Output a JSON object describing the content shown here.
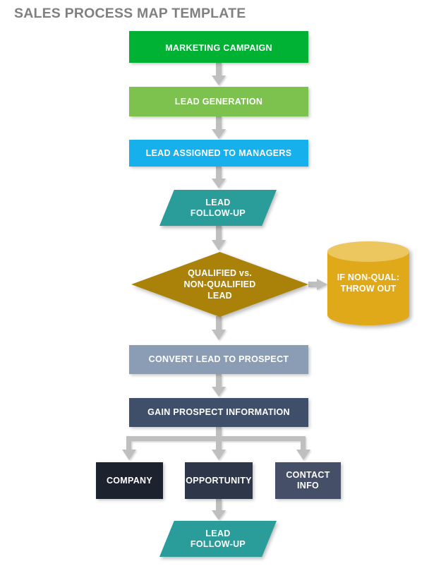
{
  "page": {
    "title": "SALES PROCESS MAP TEMPLATE",
    "background": "#ffffff",
    "title_color": "#808080",
    "connector_color": "#bfbfbf",
    "accent_bar_color": "#00b233"
  },
  "nodes": {
    "marketing_campaign": {
      "label": "MARKETING CAMPAIGN",
      "shape": "rectangle",
      "color": "#00b233"
    },
    "lead_generation": {
      "label": "LEAD GENERATION",
      "shape": "rectangle",
      "color": "#7dc24f"
    },
    "lead_assigned": {
      "label": "LEAD ASSIGNED TO MANAGERS",
      "shape": "rectangle",
      "color": "#16b0ec"
    },
    "lead_followup_top": {
      "label_line1": "LEAD",
      "label_line2": "FOLLOW-UP",
      "shape": "parallelogram",
      "color": "#2a9d9a"
    },
    "qualified_decision": {
      "label_line1": "QUALIFIED vs.",
      "label_line2": "NON-QUALIFIED",
      "label_line3": "LEAD",
      "shape": "diamond",
      "color": "#ab8209"
    },
    "non_qual_store": {
      "label_line1": "IF NON-QUAL:",
      "label_line2": "THROW OUT",
      "shape": "cylinder",
      "color": "#e0a91a",
      "top_color": "#ecc75f"
    },
    "convert_lead": {
      "label": "CONVERT LEAD TO PROSPECT",
      "shape": "rectangle",
      "color": "#8b9cb5"
    },
    "gain_prospect_info": {
      "label": "GAIN PROSPECT INFORMATION",
      "shape": "rectangle",
      "color": "#3f4f69"
    },
    "company": {
      "label": "COMPANY",
      "shape": "rectangle",
      "color": "#1c222e"
    },
    "opportunity": {
      "label": "OPPORTUNITY",
      "shape": "rectangle",
      "color": "#2e374a"
    },
    "contact_info": {
      "label_line1": "CONTACT",
      "label_line2": "INFO",
      "shape": "rectangle",
      "color": "#455068"
    },
    "lead_followup_bottom": {
      "label_line1": "LEAD",
      "label_line2": "FOLLOW-UP",
      "shape": "parallelogram",
      "color": "#2a9d9a"
    }
  }
}
